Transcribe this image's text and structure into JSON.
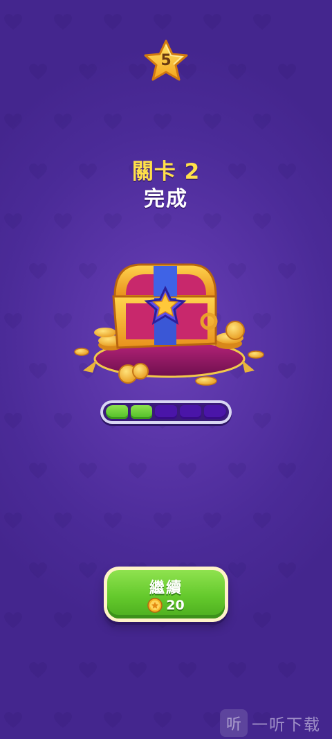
{
  "header": {
    "star_count": "5"
  },
  "level": {
    "title": "關卡 2",
    "status": "完成"
  },
  "reward": {
    "chest_icon": "treasure-chest-icon"
  },
  "progress": {
    "segments_total": 5,
    "segments_filled": 2
  },
  "continue_button": {
    "label": "繼續",
    "cost": "20",
    "cost_icon": "coin-icon"
  },
  "watermark": {
    "logo_glyph": "听",
    "text": "一听下载"
  },
  "colors": {
    "background": "#4b2b98",
    "title": "#ffe04a",
    "button_green": "#64c92c",
    "progress_green": "#5fcb30",
    "progress_empty": "#4a15a8"
  }
}
